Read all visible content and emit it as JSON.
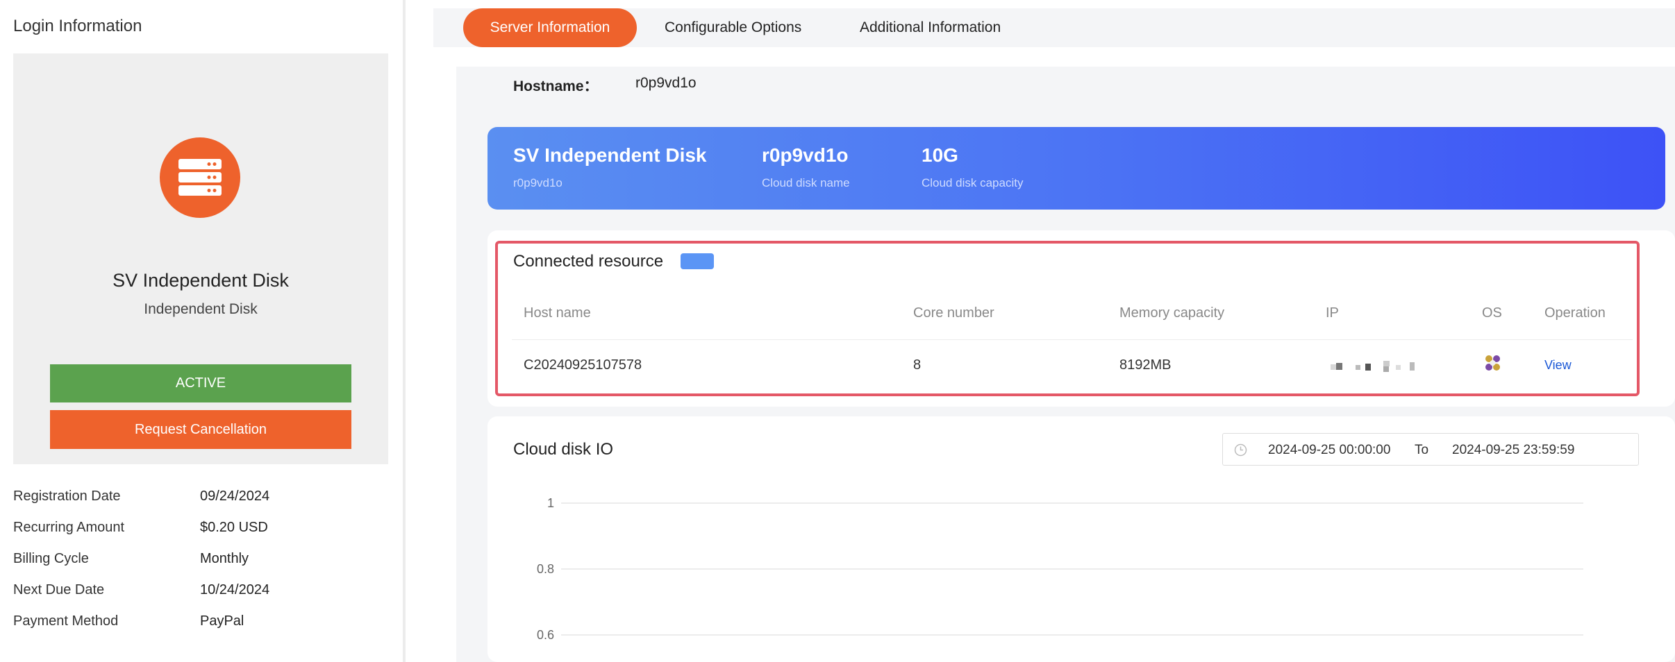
{
  "sidebar": {
    "title": "Login Information",
    "product_name": "SV Independent Disk",
    "product_type": "Independent Disk",
    "status_label": "ACTIVE",
    "cancel_label": "Request Cancellation",
    "billing": [
      {
        "key": "Registration Date",
        "value": "09/24/2024"
      },
      {
        "key": "Recurring Amount",
        "value": "$0.20 USD"
      },
      {
        "key": "Billing Cycle",
        "value": "Monthly"
      },
      {
        "key": "Next Due Date",
        "value": "10/24/2024"
      },
      {
        "key": "Payment Method",
        "value": "PayPal"
      }
    ]
  },
  "tabs": [
    {
      "label": "Server Information",
      "active": true
    },
    {
      "label": "Configurable Options",
      "active": false
    },
    {
      "label": "Additional Information",
      "active": false
    }
  ],
  "hostname": {
    "label": "Hostname：",
    "value": "r0p9vd1o"
  },
  "disk_banner": {
    "name": "SV Independent Disk",
    "name_sub": "r0p9vd1o",
    "disk_name": "r0p9vd1o",
    "disk_name_label": "Cloud disk name",
    "capacity": "10G",
    "capacity_label": "Cloud disk capacity"
  },
  "connected_resource": {
    "title": "Connected resource",
    "headers": [
      "Host name",
      "Core number",
      "Memory capacity",
      "IP",
      "OS",
      "Operation"
    ],
    "rows": [
      {
        "host": "C20240925107578",
        "cores": "8",
        "memory": "8192MB",
        "ip": "",
        "os_icon": "os-icon",
        "operation": "View"
      }
    ]
  },
  "cloud_io": {
    "title": "Cloud disk IO",
    "date_from": "2024-09-25 00:00:00",
    "date_to_label": "To",
    "date_to": "2024-09-25 23:59:59"
  },
  "chart_data": {
    "type": "line",
    "title": "",
    "xlabel": "",
    "ylabel": "",
    "y_ticks": [
      "1",
      "0.8",
      "0.6"
    ],
    "ylim": [
      0.6,
      1
    ],
    "grid": true,
    "series": []
  },
  "colors": {
    "accent": "#ee622c",
    "active_green": "#5ba24e",
    "banner_start": "#5a8ff1",
    "banner_end": "#3d52f6",
    "highlight_frame": "#e45867",
    "link": "#1a57d6"
  }
}
